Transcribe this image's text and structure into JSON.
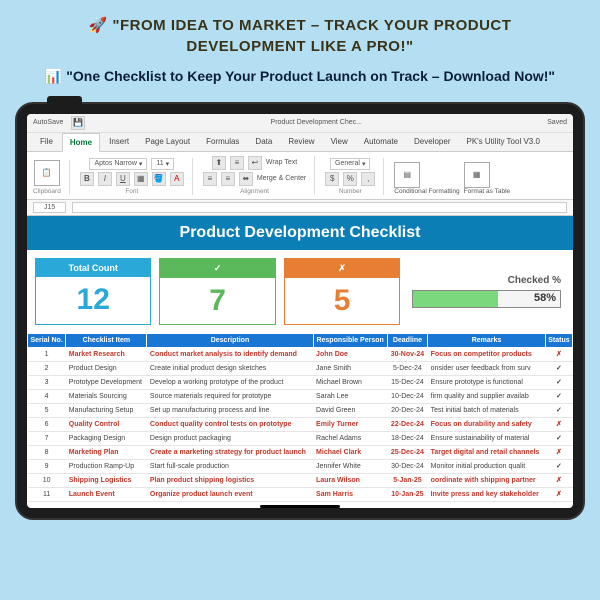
{
  "hero": {
    "title": "🚀 \"FROM IDEA TO MARKET – TRACK YOUR PRODUCT DEVELOPMENT LIKE A PRO!\"",
    "subtitle": "📊 \"One Checklist to Keep Your Product Launch on Track – Download Now!\""
  },
  "qat": {
    "autosave": "AutoSave",
    "docname": "Product Development Chec...",
    "saved": "Saved"
  },
  "tabs": {
    "file": "File",
    "home": "Home",
    "insert": "Insert",
    "pagelayout": "Page Layout",
    "formulas": "Formulas",
    "data": "Data",
    "review": "Review",
    "view": "View",
    "automate": "Automate",
    "developer": "Developer",
    "utility": "PK's Utility Tool V3.0"
  },
  "ribbon": {
    "paste": "Paste",
    "clipboard": "Clipboard",
    "font": "Aptos Narrow",
    "fontsize": "11",
    "fontgroup": "Font",
    "alignment": "Alignment",
    "wrap": "Wrap Text",
    "merge": "Merge & Center",
    "general": "General",
    "number": "Number",
    "condfmt": "Conditional Formatting",
    "fmtTable": "Format as Table"
  },
  "cellref": "J15",
  "sheet_title": "Product Development Checklist",
  "stats": {
    "total_label": "Total Count",
    "total_val": "12",
    "done_val": "7",
    "fail_val": "5",
    "checked_label": "Checked %",
    "checked_pct": "58%"
  },
  "cols": {
    "serial": "Serial No.",
    "item": "Checklist Item",
    "desc": "Description",
    "person": "Responsible Person",
    "deadline": "Deadline",
    "remarks": "Remarks",
    "status": "Status"
  },
  "rows": [
    {
      "n": "1",
      "item": "Market Research",
      "desc": "Conduct market analysis to identify demand",
      "person": "John Doe",
      "deadline": "30-Nov-24",
      "remarks": "Focus on competitor products",
      "ok": false
    },
    {
      "n": "2",
      "item": "Product Design",
      "desc": "Create initial product design sketches",
      "person": "Jane Smith",
      "deadline": "5-Dec-24",
      "remarks": "onsider user feedback from surv",
      "ok": true
    },
    {
      "n": "3",
      "item": "Prototype Development",
      "desc": "Develop a working prototype of the product",
      "person": "Michael Brown",
      "deadline": "15-Dec-24",
      "remarks": "Ensure prototype is functional",
      "ok": true
    },
    {
      "n": "4",
      "item": "Materials Sourcing",
      "desc": "Source materials required for prototype",
      "person": "Sarah Lee",
      "deadline": "10-Dec-24",
      "remarks": "firm quality and supplier availab",
      "ok": true
    },
    {
      "n": "5",
      "item": "Manufacturing Setup",
      "desc": "Set up manufacturing process and line",
      "person": "David Green",
      "deadline": "20-Dec-24",
      "remarks": "Test initial batch of materials",
      "ok": true
    },
    {
      "n": "6",
      "item": "Quality Control",
      "desc": "Conduct quality control tests on prototype",
      "person": "Emily Turner",
      "deadline": "22-Dec-24",
      "remarks": "Focus on durability and safety",
      "ok": false
    },
    {
      "n": "7",
      "item": "Packaging Design",
      "desc": "Design product packaging",
      "person": "Rachel Adams",
      "deadline": "18-Dec-24",
      "remarks": "Ensure sustainability of material",
      "ok": true
    },
    {
      "n": "8",
      "item": "Marketing Plan",
      "desc": "Create a marketing strategy for product launch",
      "person": "Michael Clark",
      "deadline": "25-Dec-24",
      "remarks": "Target digital and retail channels",
      "ok": false
    },
    {
      "n": "9",
      "item": "Production Ramp-Up",
      "desc": "Start full-scale production",
      "person": "Jennifer White",
      "deadline": "30-Dec-24",
      "remarks": "Monitor initial production qualit",
      "ok": true
    },
    {
      "n": "10",
      "item": "Shipping Logistics",
      "desc": "Plan product shipping logistics",
      "person": "Laura Wilson",
      "deadline": "5-Jan-25",
      "remarks": "oordinate with shipping partner",
      "ok": false
    },
    {
      "n": "11",
      "item": "Launch Event",
      "desc": "Organize product launch event",
      "person": "Sam Harris",
      "deadline": "10-Jan-25",
      "remarks": "Invite press and key stakeholder",
      "ok": false
    }
  ],
  "chart_data": {
    "type": "bar",
    "title": "Checked %",
    "categories": [
      "Checked"
    ],
    "values": [
      58
    ],
    "ylim": [
      0,
      100
    ]
  }
}
